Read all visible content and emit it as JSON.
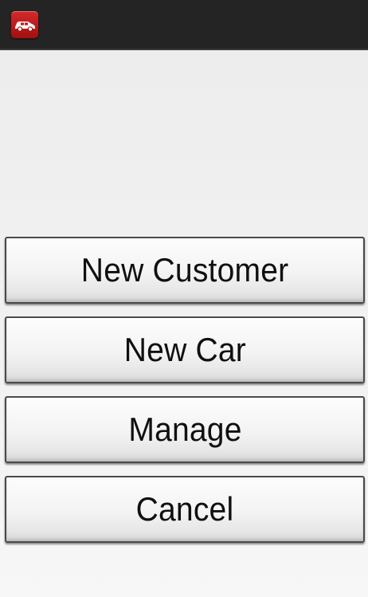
{
  "action_bar": {
    "icon": "car-app-icon",
    "icon_color": "#c21b1b",
    "background": "#242424"
  },
  "menu": {
    "buttons": [
      {
        "label": "New Customer"
      },
      {
        "label": "New Car"
      },
      {
        "label": "Manage"
      },
      {
        "label": "Cancel"
      }
    ]
  }
}
